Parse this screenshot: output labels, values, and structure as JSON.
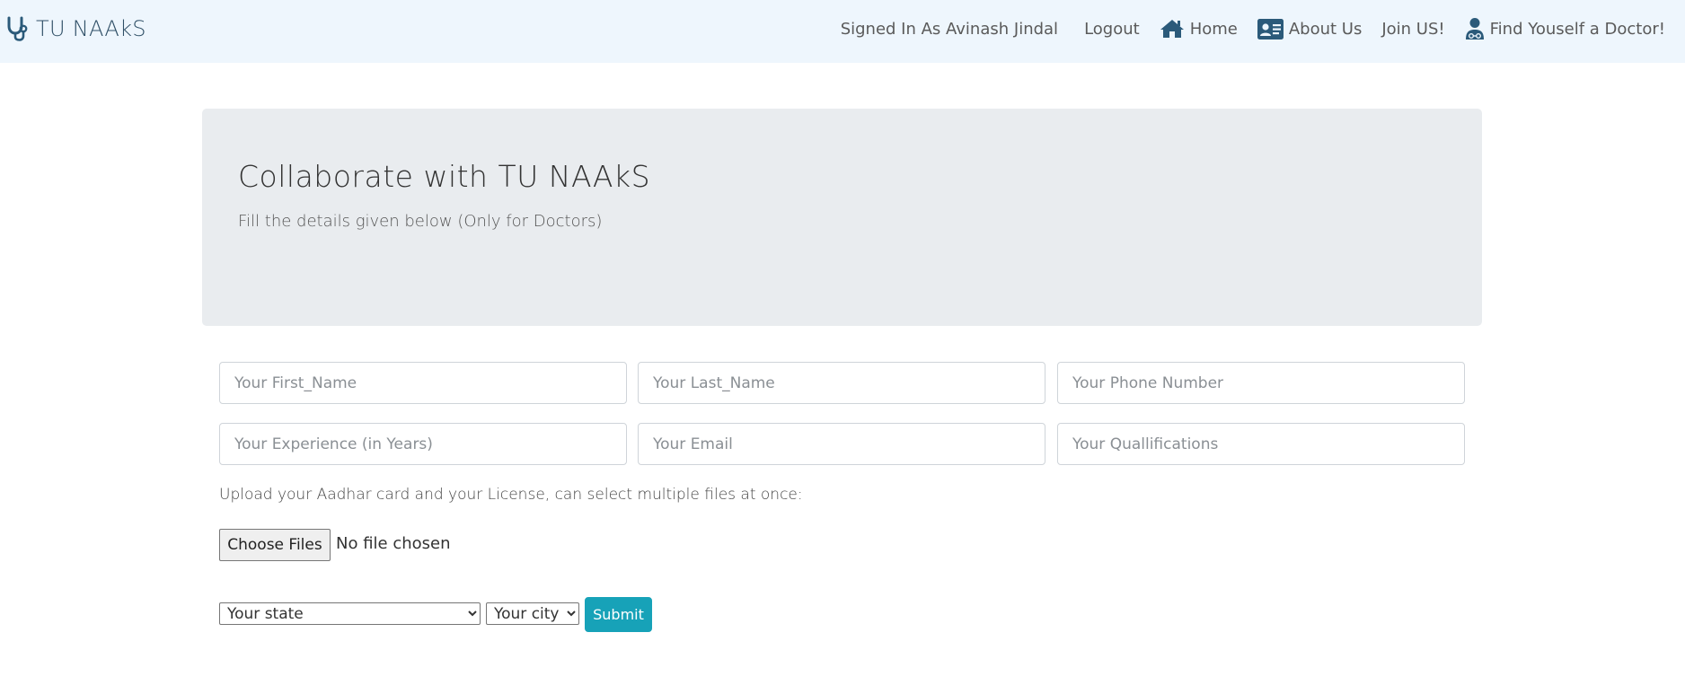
{
  "brand": {
    "name": "TU NAAkS",
    "icon": "stethoscope-icon"
  },
  "nav": {
    "signed_in": "Signed In As Avinash Jindal",
    "logout": "Logout",
    "home": "Home",
    "about": "About Us",
    "join": "Join US!",
    "find_doctor": "Find Youself a Doctor!",
    "icons": {
      "home": "home-icon",
      "about": "id-card-icon",
      "find_doctor": "doctor-icon"
    }
  },
  "hero": {
    "title": "Collaborate with TU NAAkS",
    "subtitle": "Fill the details given below (Only for Doctors)"
  },
  "form": {
    "first_name_placeholder": "Your First_Name",
    "last_name_placeholder": "Your Last_Name",
    "phone_placeholder": "Your Phone Number",
    "experience_placeholder": "Your Experience (in Years)",
    "email_placeholder": "Your Email",
    "qualifications_placeholder": "Your Quallifications",
    "upload_label": "Upload your Aadhar card and your License, can select multiple files at once:",
    "choose_files": "Choose Files",
    "no_file": "No file chosen",
    "state_selected": "Your state",
    "city_selected": "Your city",
    "submit": "Submit"
  },
  "colors": {
    "navbar_bg": "#eef6fd",
    "brand_icon": "#2b5a7a",
    "jumbotron_bg": "#e9ecef",
    "submit_bg": "#17a2b8"
  }
}
